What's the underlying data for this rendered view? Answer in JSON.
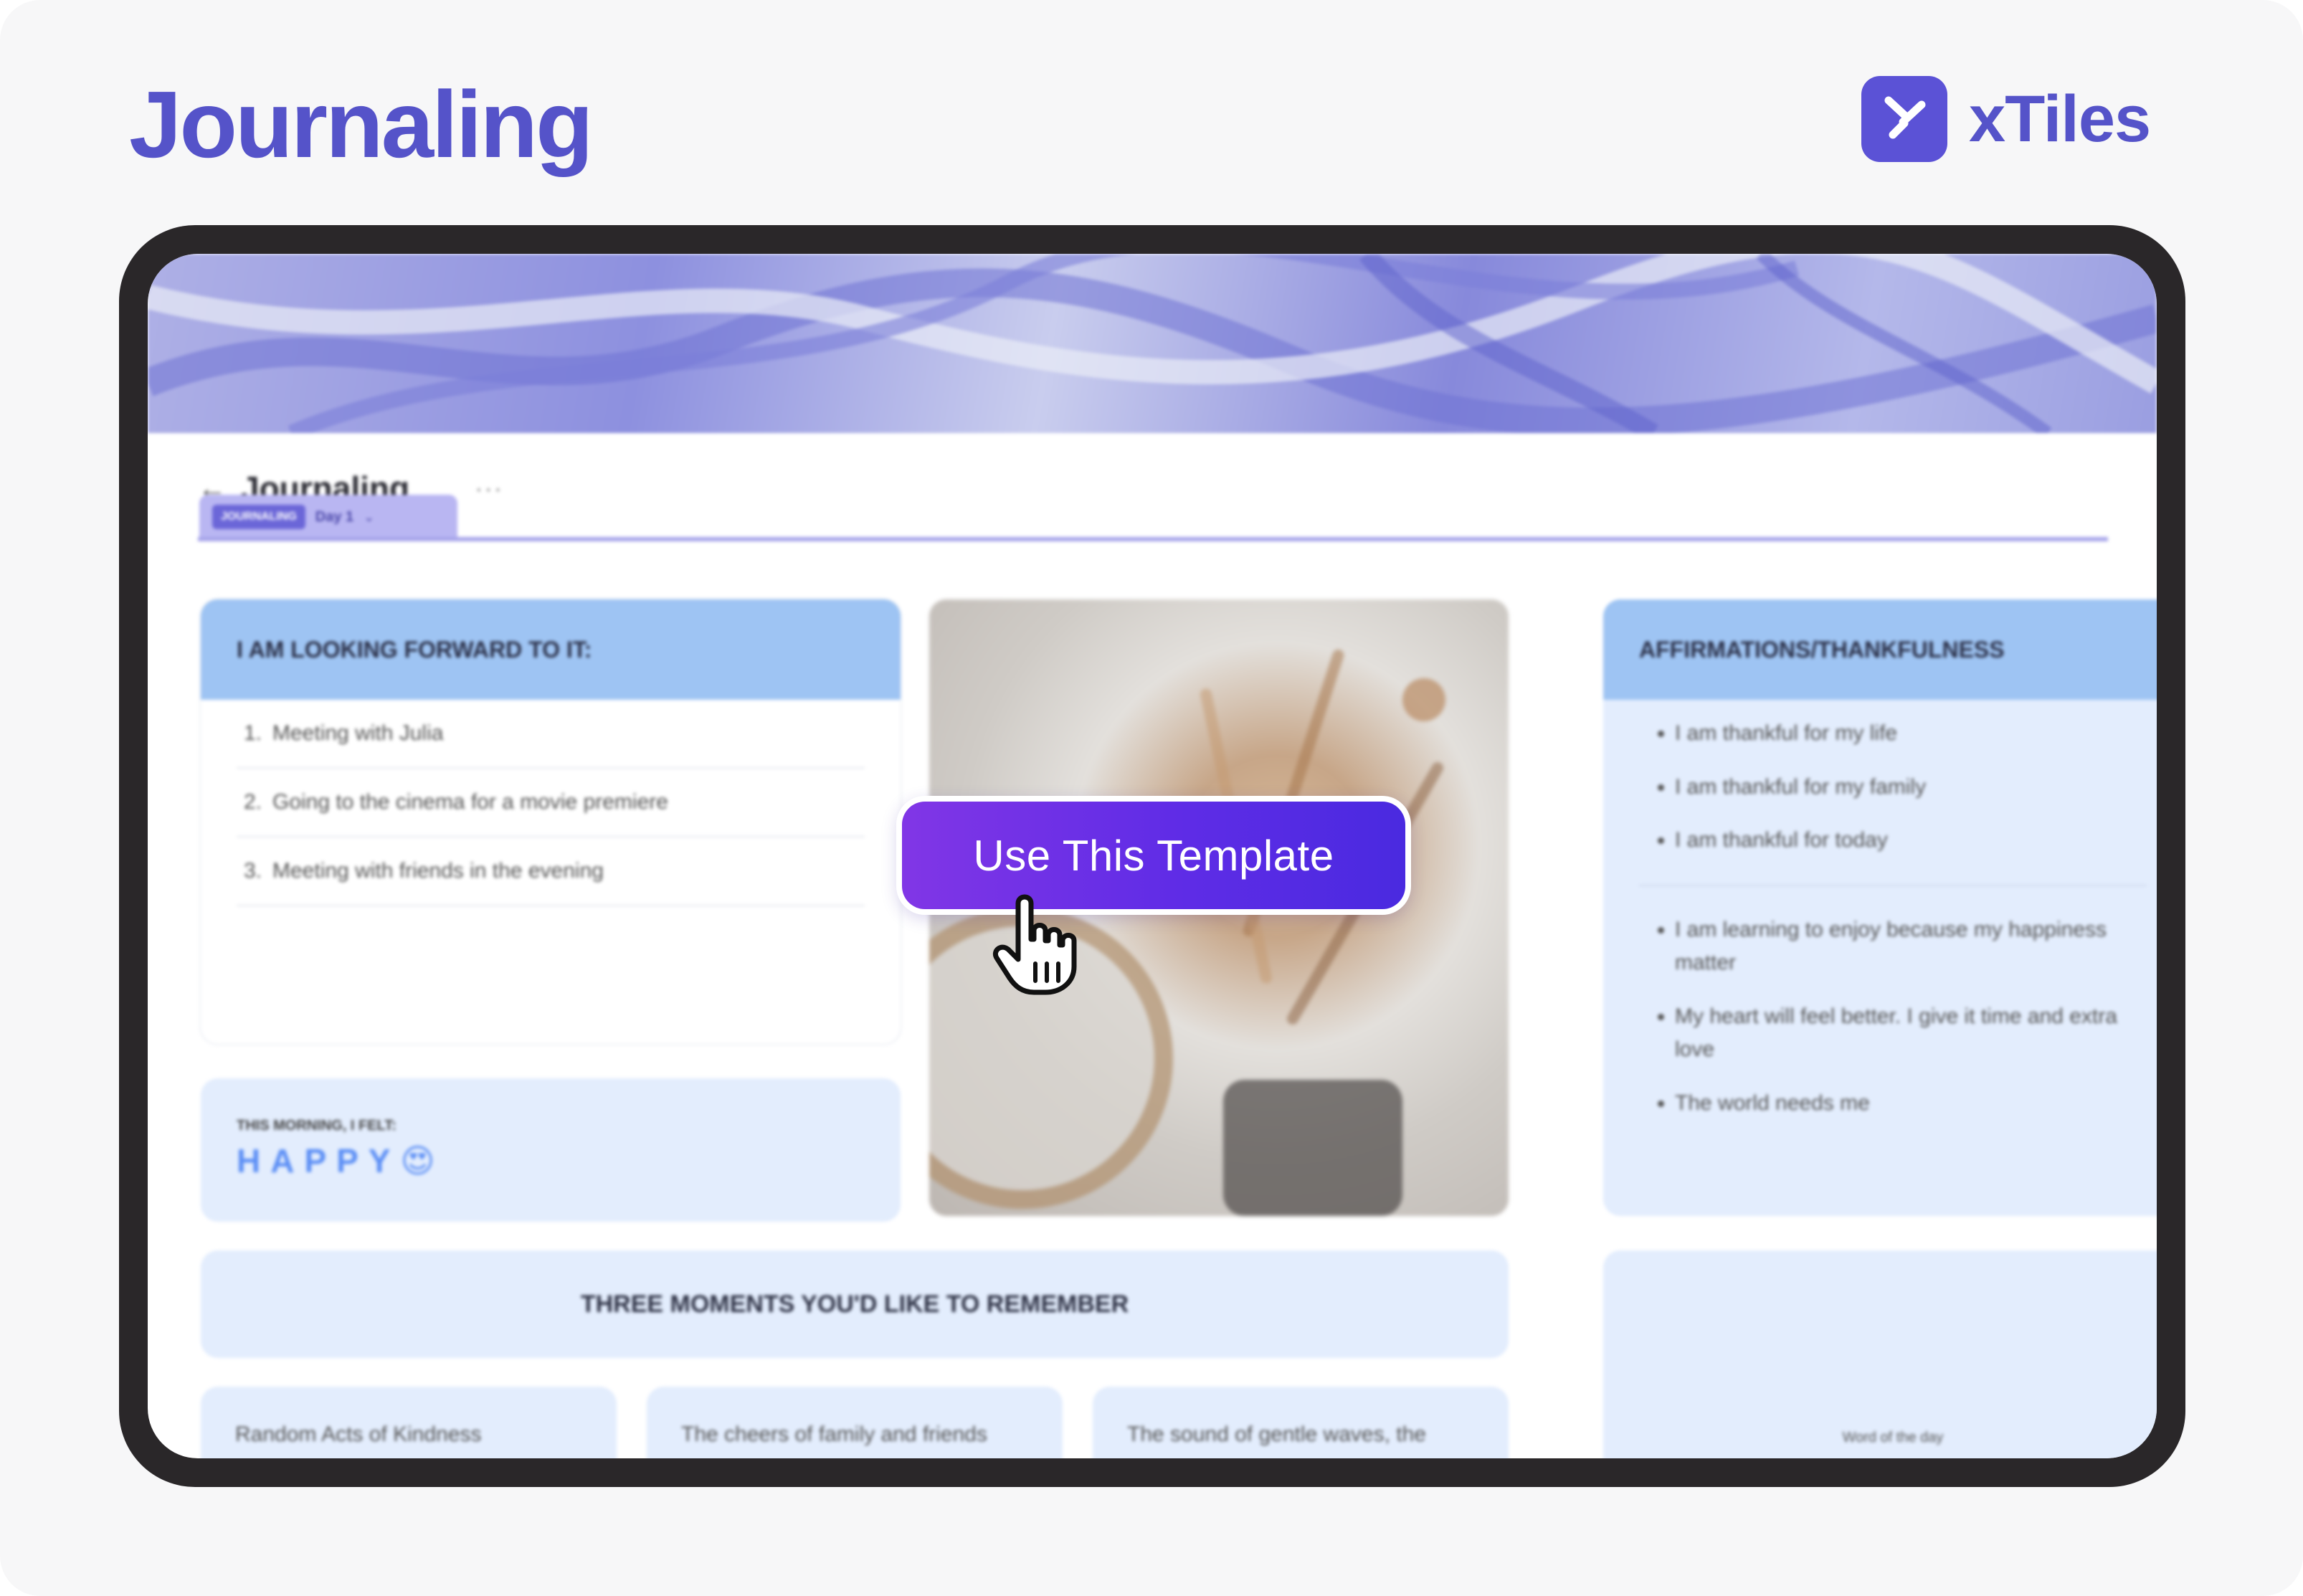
{
  "header": {
    "title": "Journaling",
    "brand_name": "xTiles",
    "brand_color": "#5b52d6"
  },
  "document": {
    "title": "Journaling",
    "tab_label": "JOURNALING",
    "tab_page": "Day 1"
  },
  "looking_forward": {
    "heading": "I AM LOOKING FORWARD TO IT:",
    "items": [
      {
        "num": "1.",
        "text": "Meeting with Julia"
      },
      {
        "num": "2.",
        "text": "Going to the cinema for a movie premiere"
      },
      {
        "num": "3.",
        "text": "Meeting with friends in the evening"
      }
    ]
  },
  "mood": {
    "label": "THIS MORNING, I FELT:",
    "word": "HAPPY",
    "emoji": "😍"
  },
  "affirmations": {
    "heading": "AFFIRMATIONS/THANKFULNESS",
    "group1": [
      "I am thankful for my life",
      "I am thankful for my family",
      "I am thankful for today"
    ],
    "group2": [
      "I am learning to enjoy because my happiness matter",
      "My heart will feel better. I give it time and extra love",
      "The world needs me"
    ]
  },
  "moments": {
    "heading": "THREE MOMENTS YOU'D LIKE TO REMEMBER",
    "cards": [
      "Random Acts of Kindness",
      "The cheers of family and friends",
      "The sound of gentle waves, the"
    ]
  },
  "word_of_day": {
    "label": "Word of the day"
  },
  "cta": {
    "label": "Use This Template",
    "gradient_start": "#8136e6",
    "gradient_end": "#4a2ae0"
  }
}
